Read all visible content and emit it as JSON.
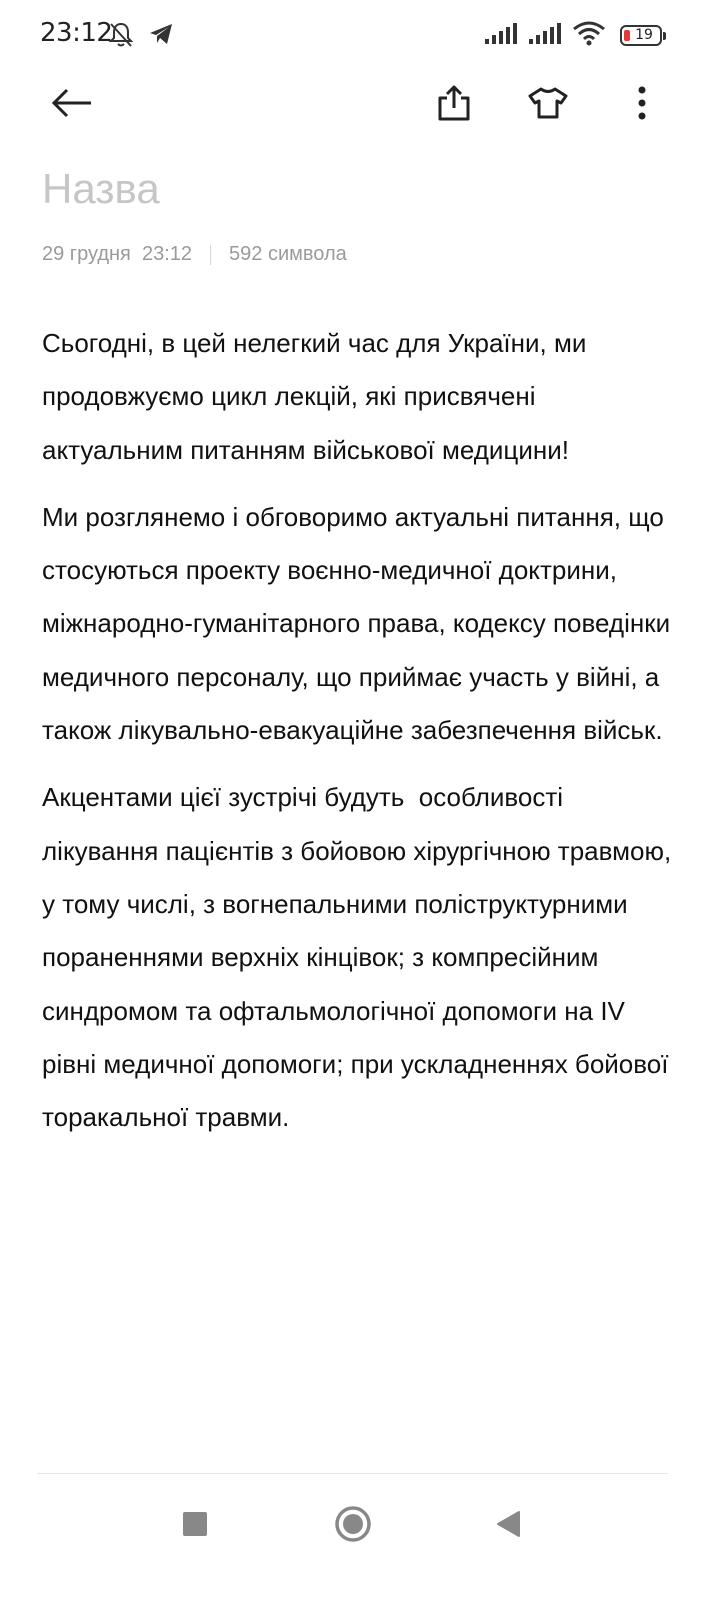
{
  "status_bar": {
    "time": "23:12",
    "battery_level": "19",
    "left_icons": [
      "bell-off-icon",
      "telegram-icon"
    ],
    "right_icons": [
      "signal-icon",
      "signal-icon",
      "wifi-icon",
      "battery-icon"
    ]
  },
  "toolbar": {
    "icons": [
      "back-arrow-icon",
      "share-icon",
      "theme-shirt-icon",
      "more-vert-icon"
    ]
  },
  "note": {
    "title_placeholder": "Назва",
    "date": "29 грудня  23:12",
    "char_count": "592 символа",
    "paragraphs": [
      "Сьогодні, в цей нелегкий час для України, ми продовжуємо цикл лекцій, які присвячені актуальним питанням військової медицини!",
      "Ми розглянемо і обговоримо актуальні питання, що стосуються проекту воєнно-медичної доктрини, міжнародно-гуманітарного права, кодексу поведінки медичного персоналу, що приймає участь у війні, а також лікувально-евакуаційне забезпечення військ.",
      "Акцентами цієї зустрічі будуть  особливості лікування пацієнтів з бойовою хірургічною травмою, у тому числі, з вогнепальними поліструктурними пораненнями верхніх кінцівок; з компресійним синдромом та офтальмологічної допомоги на IV рівні медичної допомоги; при ускладненнях бойової торакальної травми."
    ]
  },
  "nav_bar": {
    "icons": [
      "recents-square-icon",
      "home-circle-icon",
      "back-triangle-icon"
    ]
  }
}
